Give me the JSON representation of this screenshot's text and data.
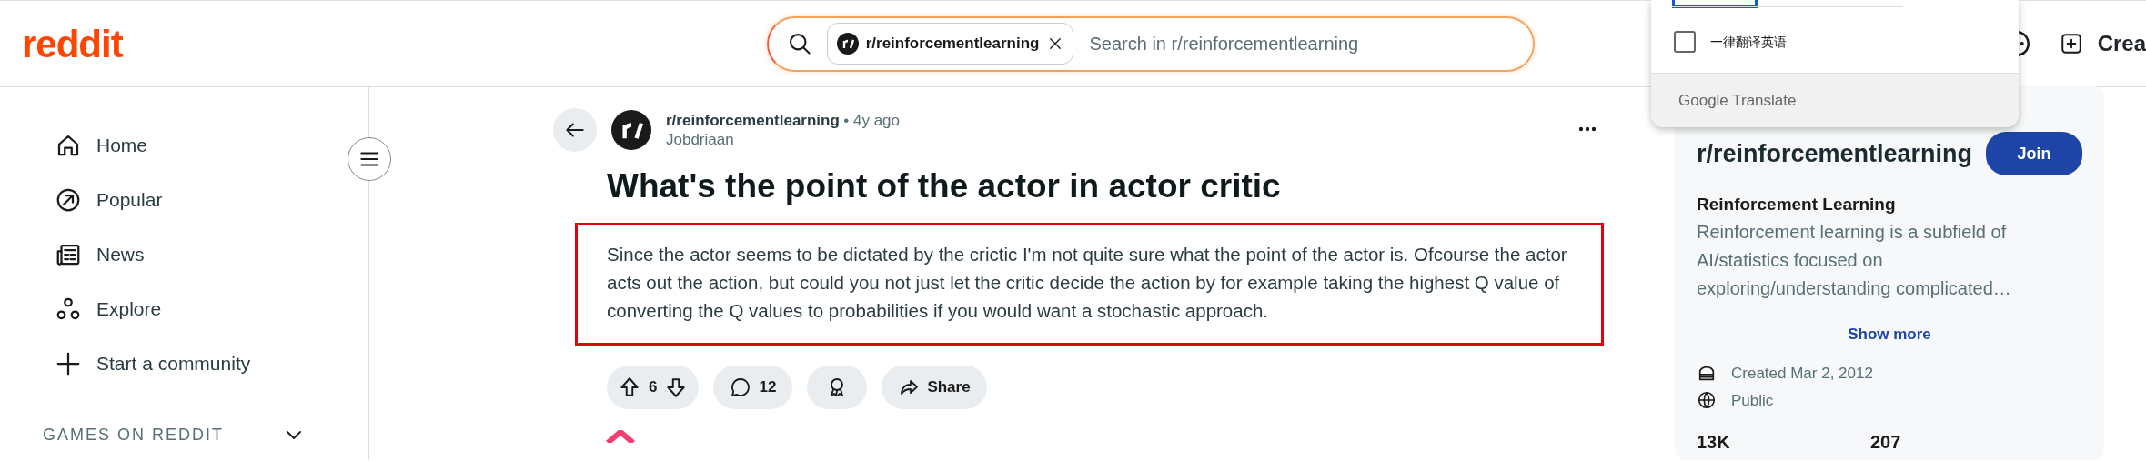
{
  "header": {
    "logo": "reddit",
    "search": {
      "chip": "r/reinforcementlearning",
      "placeholder": "Search in r/reinforcementlearning"
    },
    "create": "Crea"
  },
  "translate_popup": {
    "option": {
      "label": "一律翻译英语",
      "checked": false
    },
    "footer": "Google Translate"
  },
  "sidebar": {
    "items": [
      {
        "label": "Home"
      },
      {
        "label": "Popular"
      },
      {
        "label": "News"
      },
      {
        "label": "Explore"
      },
      {
        "label": "Start a community"
      }
    ],
    "section": {
      "label": "GAMES ON REDDIT",
      "expanded": false
    }
  },
  "post": {
    "subreddit": "r/reinforcementlearning",
    "age": "• 4y ago",
    "author": "Jobdriaan",
    "title": "What's the point of the actor in actor critic",
    "body": "Since the actor seems to be dictated by the crictic I'm not quite sure what the point of the actor is. Ofcourse the actor acts out the action, but could you not just let the critic decide the action by for example taking the highest Q value of converting the Q values to probabilities if you would want a stochastic approach.",
    "votes": "6",
    "comments": "12",
    "share": "Share"
  },
  "community": {
    "name": "r/reinforcementlearning",
    "join": "Join",
    "title": "Reinforcement Learning",
    "description": "Reinforcement learning is a subfield of AI/statistics focused on exploring/understanding complicated…",
    "show_more": "Show more",
    "created": "Created Mar 2, 2012",
    "visibility": "Public",
    "stats": [
      "13K",
      "207"
    ]
  }
}
